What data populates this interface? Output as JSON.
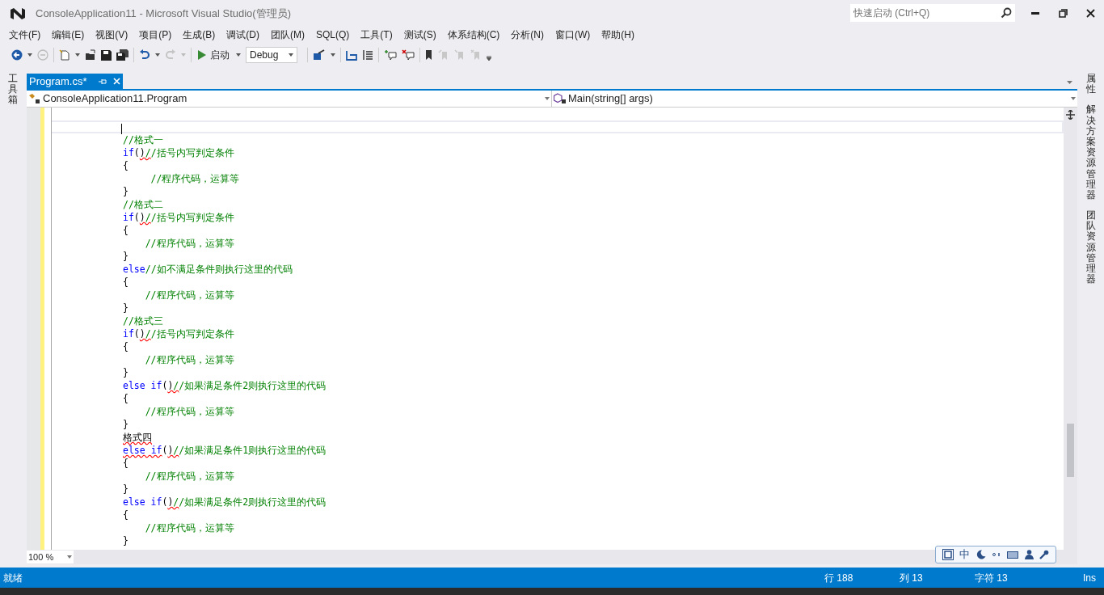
{
  "window": {
    "title": "ConsoleApplication11 - Microsoft Visual Studio(管理员)",
    "quick_launch": {
      "placeholder": "快速启动 (Ctrl+Q)"
    }
  },
  "menu": [
    "文件(F)",
    "编辑(E)",
    "视图(V)",
    "项目(P)",
    "生成(B)",
    "调试(D)",
    "团队(M)",
    "SQL(Q)",
    "工具(T)",
    "测试(S)",
    "体系结构(C)",
    "分析(N)",
    "窗口(W)",
    "帮助(H)"
  ],
  "toolbar": {
    "start_label": "启动",
    "configuration": "Debug"
  },
  "tabs": [
    {
      "label": "Program.cs*",
      "selected": true
    }
  ],
  "navigation": {
    "type_dropdown": "ConsoleApplication11.Program",
    "member_dropdown": "Main(string[] args)"
  },
  "left_dock": [
    {
      "label": "工具箱"
    }
  ],
  "right_dock": [
    {
      "label": "属性"
    },
    {
      "label": "解决方案资源管理器"
    },
    {
      "label": "团队资源管理器"
    }
  ],
  "code_lines": [
    {
      "current": true
    },
    {
      "current": false,
      "segments": [
        {
          "kind": "comment",
          "text": "//格式一"
        }
      ]
    },
    {
      "current": false,
      "segments": [
        {
          "kind": "keyword",
          "text": "if"
        },
        {
          "kind": "plain",
          "text": "("
        },
        {
          "kind": "plain",
          "text": ")",
          "squiggle": true
        },
        {
          "kind": "comment",
          "text": "/",
          "squiggle": true
        },
        {
          "kind": "comment",
          "text": "/括号内写判定条件"
        }
      ]
    },
    {
      "current": false,
      "segments": [
        {
          "kind": "plain",
          "text": "{"
        }
      ]
    },
    {
      "current": false,
      "segments": [
        {
          "kind": "comment",
          "text": "     //程序代码，运算等"
        }
      ]
    },
    {
      "current": false,
      "segments": [
        {
          "kind": "plain",
          "text": "}"
        }
      ]
    },
    {
      "current": false,
      "segments": [
        {
          "kind": "comment",
          "text": "//格式二"
        }
      ]
    },
    {
      "current": false,
      "segments": [
        {
          "kind": "keyword",
          "text": "if"
        },
        {
          "kind": "plain",
          "text": "("
        },
        {
          "kind": "plain",
          "text": ")",
          "squiggle": true
        },
        {
          "kind": "comment",
          "text": "/",
          "squiggle": true
        },
        {
          "kind": "comment",
          "text": "/括号内写判定条件"
        }
      ]
    },
    {
      "current": false,
      "segments": [
        {
          "kind": "plain",
          "text": "{"
        }
      ]
    },
    {
      "current": false,
      "segments": [
        {
          "kind": "comment",
          "text": "    //程序代码，运算等"
        }
      ]
    },
    {
      "current": false,
      "segments": [
        {
          "kind": "plain",
          "text": "}"
        }
      ]
    },
    {
      "current": false,
      "segments": [
        {
          "kind": "keyword",
          "text": "else"
        },
        {
          "kind": "comment",
          "text": "//如不满足条件则执行这里的代码"
        }
      ]
    },
    {
      "current": false,
      "segments": [
        {
          "kind": "plain",
          "text": "{"
        }
      ]
    },
    {
      "current": false,
      "segments": [
        {
          "kind": "comment",
          "text": "    //程序代码，运算等"
        }
      ]
    },
    {
      "current": false,
      "segments": [
        {
          "kind": "plain",
          "text": "}"
        }
      ]
    },
    {
      "current": false,
      "segments": [
        {
          "kind": "comment",
          "text": "//格式三"
        }
      ]
    },
    {
      "current": false,
      "segments": [
        {
          "kind": "keyword",
          "text": "if"
        },
        {
          "kind": "plain",
          "text": "("
        },
        {
          "kind": "plain",
          "text": ")",
          "squiggle": true
        },
        {
          "kind": "comment",
          "text": "/",
          "squiggle": true
        },
        {
          "kind": "comment",
          "text": "/括号内写判定条件"
        }
      ]
    },
    {
      "current": false,
      "segments": [
        {
          "kind": "plain",
          "text": "{"
        }
      ]
    },
    {
      "current": false,
      "segments": [
        {
          "kind": "comment",
          "text": "    //程序代码，运算等"
        }
      ]
    },
    {
      "current": false,
      "segments": [
        {
          "kind": "plain",
          "text": "}"
        }
      ]
    },
    {
      "current": false,
      "segments": [
        {
          "kind": "keyword",
          "text": "else if"
        },
        {
          "kind": "plain",
          "text": "("
        },
        {
          "kind": "plain",
          "text": ")",
          "squiggle": true
        },
        {
          "kind": "comment",
          "text": "/",
          "squiggle": true
        },
        {
          "kind": "comment",
          "text": "/如果满足条件2则执行这里的代码"
        }
      ]
    },
    {
      "current": false,
      "segments": [
        {
          "kind": "plain",
          "text": "{"
        }
      ]
    },
    {
      "current": false,
      "segments": [
        {
          "kind": "comment",
          "text": "    //程序代码，运算等"
        }
      ]
    },
    {
      "current": false,
      "segments": [
        {
          "kind": "plain",
          "text": "}"
        }
      ]
    },
    {
      "current": false,
      "segments": [
        {
          "kind": "plain",
          "text": "格式四",
          "squiggle": true
        }
      ]
    },
    {
      "current": false,
      "segments": [
        {
          "kind": "keyword",
          "text": "else",
          "squiggle": true
        },
        {
          "kind": "keyword",
          "text": " if",
          "squiggle": true
        },
        {
          "kind": "plain",
          "text": "("
        },
        {
          "kind": "plain",
          "text": ")",
          "squiggle": true
        },
        {
          "kind": "comment",
          "text": "/",
          "squiggle": true
        },
        {
          "kind": "comment",
          "text": "/如果满足条件1则执行这里的代码"
        }
      ]
    },
    {
      "current": false,
      "segments": [
        {
          "kind": "plain",
          "text": "{"
        }
      ]
    },
    {
      "current": false,
      "segments": [
        {
          "kind": "comment",
          "text": "    //程序代码，运算等"
        }
      ]
    },
    {
      "current": false,
      "segments": [
        {
          "kind": "plain",
          "text": "}"
        }
      ]
    },
    {
      "current": false,
      "segments": [
        {
          "kind": "keyword",
          "text": "else if"
        },
        {
          "kind": "plain",
          "text": "("
        },
        {
          "kind": "plain",
          "text": ")",
          "squiggle": true
        },
        {
          "kind": "comment",
          "text": "/",
          "squiggle": true
        },
        {
          "kind": "comment",
          "text": "/如果满足条件2则执行这里的代码"
        }
      ]
    },
    {
      "current": false,
      "segments": [
        {
          "kind": "plain",
          "text": "{"
        }
      ]
    },
    {
      "current": false,
      "segments": [
        {
          "kind": "comment",
          "text": "    //程序代码，运算等"
        }
      ]
    },
    {
      "current": false,
      "segments": [
        {
          "kind": "plain",
          "text": "}"
        }
      ]
    }
  ],
  "zoom": "100 %",
  "ime": {
    "language": "中"
  },
  "status": {
    "state": "就绪",
    "line": "行 188",
    "column": "列 13",
    "character": "字符 13",
    "mode": "Ins"
  }
}
